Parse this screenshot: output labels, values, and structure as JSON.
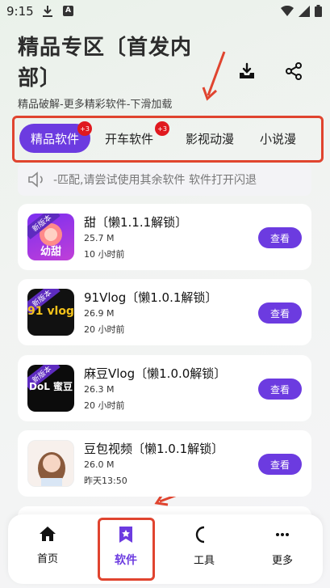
{
  "status_bar": {
    "time": "9:15",
    "a_badge": "A"
  },
  "header": {
    "title": "精品专区〔首发内部〕",
    "subtitle": "精品破解-更多精彩软件-下滑加载"
  },
  "tabs": [
    {
      "label": "精品软件",
      "badge": "+3"
    },
    {
      "label": "开车软件",
      "badge": "+3"
    },
    {
      "label": "影视动漫"
    },
    {
      "label": "小说漫"
    }
  ],
  "notice": {
    "text": "-匹配,请尝试使用其余软件   软件打开闪退"
  },
  "apps": [
    {
      "name": "甜〔懒1.1.1解锁〕",
      "size": "25.7 M",
      "time": "10 小时前",
      "button": "查看",
      "icon_text": "幼甜",
      "tag": "新版本"
    },
    {
      "name": "91Vlog〔懒1.0.1解锁〕",
      "size": "26.9 M",
      "time": "20 小时前",
      "button": "查看",
      "icon_text": "91 vlog",
      "tag": "新版本"
    },
    {
      "name": "麻豆Vlog〔懒1.0.0解锁〕",
      "size": "26.3 M",
      "time": "20 小时前",
      "button": "查看",
      "icon_text": "DoL 蜜豆",
      "tag": "新版本"
    },
    {
      "name": "豆包视频〔懒1.0.1解锁〕",
      "size": "26.0 M",
      "time": "昨天13:50",
      "button": "查看"
    }
  ],
  "bottom_nav": [
    {
      "label": "首页"
    },
    {
      "label": "软件"
    },
    {
      "label": "工具"
    },
    {
      "label": "更多"
    }
  ],
  "colors": {
    "accent": "#6c3be0",
    "annotation": "#e0442f",
    "badge": "#e0191f"
  }
}
